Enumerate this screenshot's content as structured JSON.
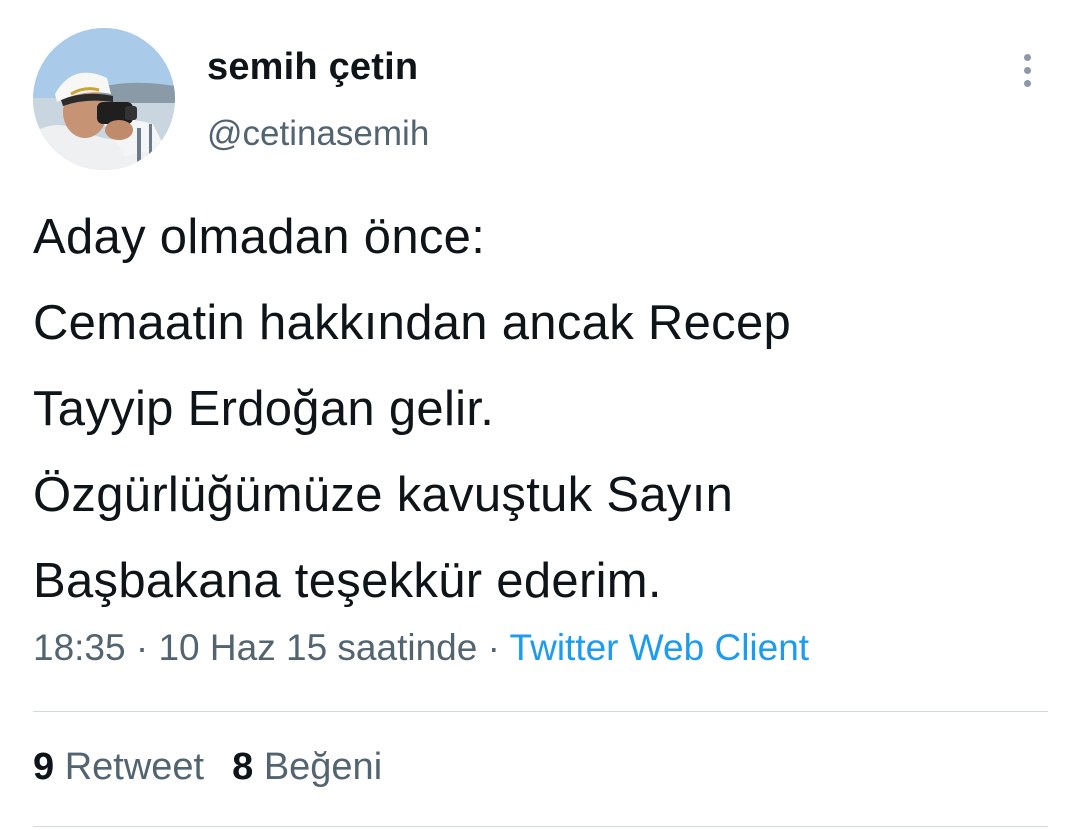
{
  "author": {
    "display_name": "semih çetin",
    "handle": "@cetinasemih"
  },
  "tweet": {
    "lines": [
      "Aday olmadan önce:",
      "Cemaatin hakkından ancak Recep",
      "Tayyip Erdoğan gelir.",
      "Özgürlüğümüze kavuştuk Sayın",
      "Başbakana teşekkür ederim."
    ],
    "time": "18:35",
    "date": "10 Haz 15 saatinde",
    "separator": " · ",
    "source": "Twitter Web Client"
  },
  "stats": {
    "retweets": "9",
    "retweets_label": "Retweet",
    "likes": "8",
    "likes_label": "Beğeni"
  },
  "icons": {
    "more": "more-vertical-icon"
  },
  "colors": {
    "text": "#0f1419",
    "secondary": "#536471",
    "link": "#1d9bf0",
    "divider": "#cfd9de"
  }
}
